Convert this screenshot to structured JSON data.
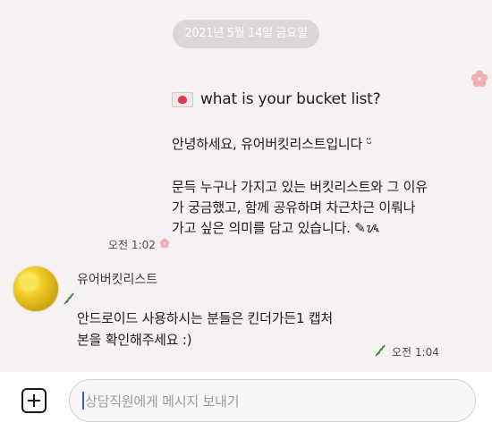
{
  "date_divider": "2021년 5월 14일 금요일",
  "message1": {
    "title": "what is your bucket list?",
    "greeting": "안녕하세요, 유어버킷리스트입니다 ᵕ̈",
    "body_lines": [
      "문득 누구나 가지고 있는 버킷리스트와 그 이유",
      "가 궁금했고, 함께 공유하며 차근차근 이뤄나",
      "가고 싶은 의미를 담고 있습니다. ✎ᝰ"
    ],
    "time": "오전 1:02"
  },
  "message2": {
    "sender": "유어버킷리스트",
    "lines": [
      "안드로이드 사용하시는 분들은 킨더가든1 캡처",
      "본을 확인해주세요 :)"
    ],
    "time": "오전 1:04"
  },
  "composer": {
    "placeholder": "상담직원에게 메시지 보내기"
  },
  "icons": {
    "envelope": "envelope-heart-icon",
    "add": "plus-icon",
    "flower": "pink-flower-icon",
    "leaf": "leaf-icon"
  },
  "colors": {
    "background": "#f7f2f2",
    "date_pill": "#dcd6d6",
    "flower": "#f3aeb6",
    "caret": "#3a5bd8"
  }
}
